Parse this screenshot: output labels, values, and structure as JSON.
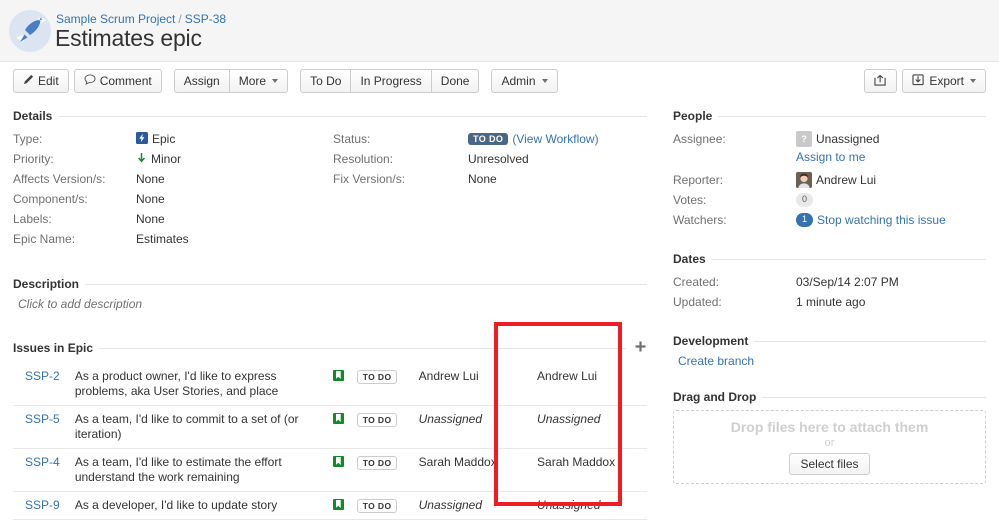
{
  "header": {
    "project_icon": "rocket-icon",
    "breadcrumb_project": "Sample Scrum Project",
    "breadcrumb_sep": "/",
    "breadcrumb_key": "SSP-38",
    "title": "Estimates epic"
  },
  "toolbar": {
    "edit": "Edit",
    "comment": "Comment",
    "assign": "Assign",
    "more": "More",
    "todo": "To Do",
    "in_progress": "In Progress",
    "done": "Done",
    "admin": "Admin",
    "share": "",
    "export": "Export"
  },
  "details": {
    "heading": "Details",
    "left": [
      {
        "key": "Type:",
        "value": "Epic",
        "icon": "epic-icon"
      },
      {
        "key": "Priority:",
        "value": "Minor",
        "icon": "priority-minor-icon"
      },
      {
        "key": "Affects Version/s:",
        "value": "None",
        "icon": ""
      },
      {
        "key": "Component/s:",
        "value": "None",
        "icon": ""
      },
      {
        "key": "Labels:",
        "value": "None",
        "icon": ""
      },
      {
        "key": "Epic Name:",
        "value": "Estimates",
        "icon": ""
      }
    ],
    "right": [
      {
        "key": "Status:",
        "value": "To Do",
        "link": "(View Workflow)"
      },
      {
        "key": "Resolution:",
        "value": "Unresolved",
        "link": ""
      },
      {
        "key": "Fix Version/s:",
        "value": "None",
        "link": ""
      }
    ]
  },
  "description": {
    "heading": "Description",
    "placeholder": "Click to add description"
  },
  "issues_in_epic": {
    "heading": "Issues in Epic",
    "add_label": "+",
    "rows": [
      {
        "key": "SSP-2",
        "summary": "As a product owner, I'd like to express problems, aka User Stories, and place",
        "type_icon": "story-icon",
        "status": "To Do",
        "assignee": "Andrew Lui",
        "assignee_italic": false,
        "assignee2": "Andrew Lui",
        "assignee2_italic": false
      },
      {
        "key": "SSP-5",
        "summary": "As a team, I'd like to commit to a set of (or iteration)",
        "type_icon": "story-icon",
        "status": "To Do",
        "assignee": "Unassigned",
        "assignee_italic": true,
        "assignee2": "Unassigned",
        "assignee2_italic": true
      },
      {
        "key": "SSP-4",
        "summary": "As a team, I'd like to estimate the effort understand the work remaining",
        "type_icon": "story-icon",
        "status": "To Do",
        "assignee": "Sarah Maddox",
        "assignee_italic": false,
        "assignee2": "Sarah Maddox",
        "assignee2_italic": false
      },
      {
        "key": "SSP-9",
        "summary": "As a developer, I'd like to update story",
        "type_icon": "story-icon",
        "status": "To Do",
        "assignee": "Unassigned",
        "assignee_italic": true,
        "assignee2": "Unassigned",
        "assignee2_italic": true
      }
    ]
  },
  "people": {
    "heading": "People",
    "assignee_key": "Assignee:",
    "assignee_value": "Unassigned",
    "assign_to_me": "Assign to me",
    "reporter_key": "Reporter:",
    "reporter_value": "Andrew Lui",
    "votes_key": "Votes:",
    "votes_value": "0",
    "watchers_key": "Watchers:",
    "watchers_value": "1",
    "watchers_link": "Stop watching this issue"
  },
  "dates": {
    "heading": "Dates",
    "created_key": "Created:",
    "created_value": "03/Sep/14 2:07 PM",
    "updated_key": "Updated:",
    "updated_value": "1 minute ago"
  },
  "development": {
    "heading": "Development",
    "create_branch": "Create branch"
  },
  "drag_and_drop": {
    "heading": "Drag and Drop",
    "main_text": "Drop files here to attach them",
    "or_text": "or",
    "button": "Select files"
  },
  "colors": {
    "link": "#3572b0",
    "status_todo_bg": "#4a6785",
    "story_green": "#14892c",
    "epic_blue": "#2a5b9e",
    "highlight_red": "#ee1c25",
    "header_bg": "#f5f5f5"
  }
}
